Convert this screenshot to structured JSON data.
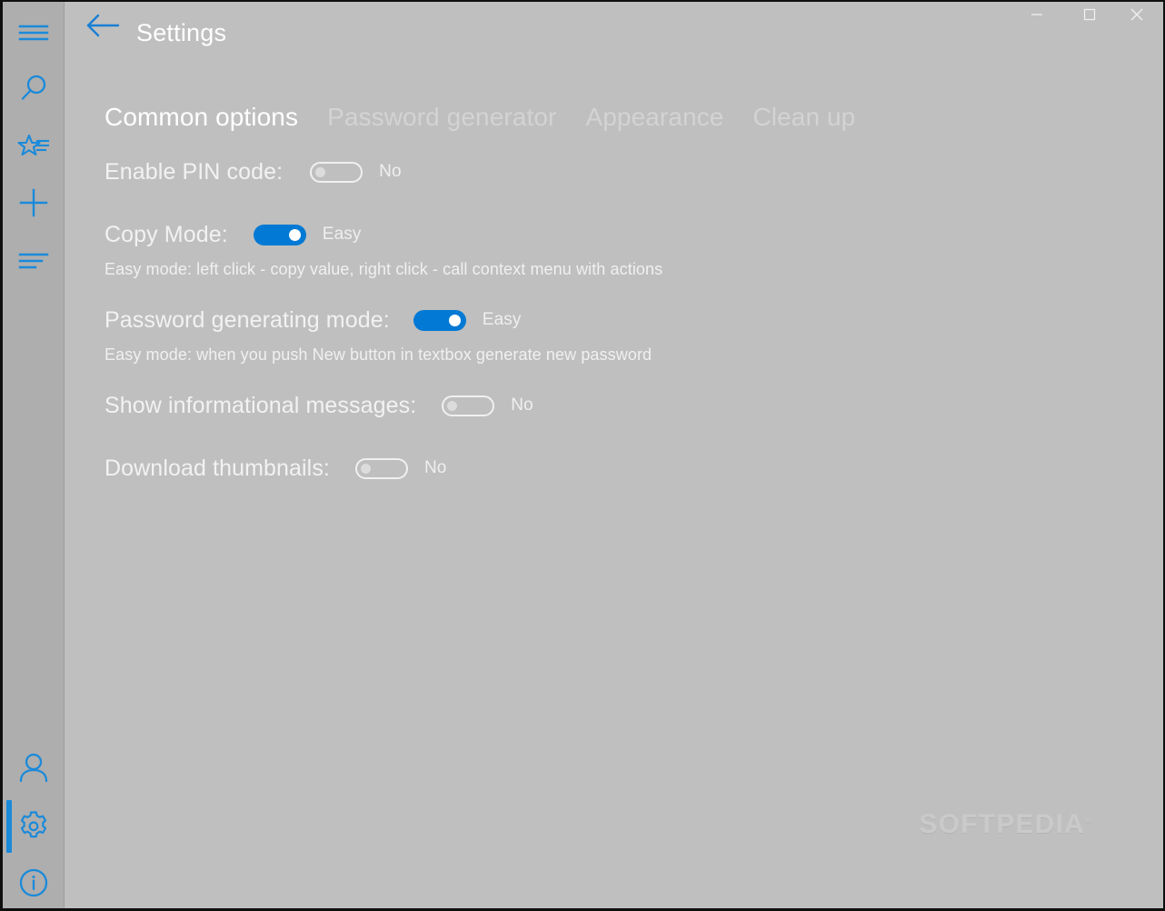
{
  "window": {
    "title": "Settings",
    "controls": {
      "minimize": "minimize-icon",
      "maximize": "maximize-icon",
      "close": "close-icon"
    },
    "back": "back-arrow-icon"
  },
  "colors": {
    "accent_blue": "#0279d4",
    "rail_icon_blue": "#1a8ada",
    "window_bg": "#bfbfbf",
    "rail_bg": "#aeaeae",
    "label_text": "#f2f2f2",
    "tab_inactive": "#d3d3d3",
    "tab_active": "#ffffff"
  },
  "sidebar": {
    "items": [
      {
        "id": "menu",
        "icon": "hamburger-menu-icon",
        "selected": false
      },
      {
        "id": "search",
        "icon": "search-icon",
        "selected": false
      },
      {
        "id": "favorites",
        "icon": "star-list-icon",
        "selected": false
      },
      {
        "id": "add",
        "icon": "plus-icon",
        "selected": false
      },
      {
        "id": "sort",
        "icon": "sort-list-icon",
        "selected": false
      },
      {
        "id": "account",
        "icon": "person-icon",
        "selected": false
      },
      {
        "id": "settings",
        "icon": "gear-icon",
        "selected": true
      },
      {
        "id": "about",
        "icon": "info-circle-icon",
        "selected": false
      }
    ]
  },
  "tabs": [
    {
      "label": "Common options",
      "active": true
    },
    {
      "label": "Password generator",
      "active": false
    },
    {
      "label": "Appearance",
      "active": false
    },
    {
      "label": "Clean up",
      "active": false
    }
  ],
  "settings": [
    {
      "label": "Enable PIN code:",
      "value": "No",
      "state": "off",
      "hint": null
    },
    {
      "label": "Copy Mode:",
      "value": "Easy",
      "state": "on",
      "hint": "Easy mode: left click - copy value, right click - call context menu with actions"
    },
    {
      "label": "Password generating mode:",
      "value": "Easy",
      "state": "on",
      "hint": "Easy mode: when you push New button in textbox generate new password"
    },
    {
      "label": "Show informational messages:",
      "value": "No",
      "state": "off",
      "hint": null
    },
    {
      "label": "Download thumbnails:",
      "value": "No",
      "state": "off",
      "hint": null
    }
  ],
  "watermark": {
    "text": "SOFTPEDIA",
    "mark": "®"
  }
}
